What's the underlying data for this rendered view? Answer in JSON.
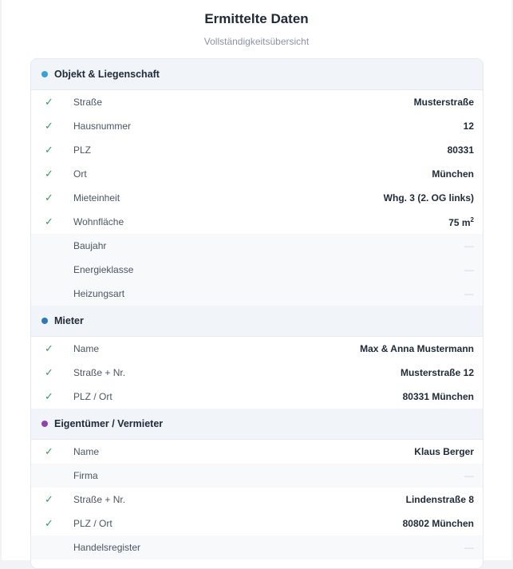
{
  "header": {
    "title": "Ermittelte Daten",
    "subtitle": "Vollständigkeitsübersicht"
  },
  "colors": {
    "check": "#2f9e63",
    "dot_objekt": "#3aa0d8",
    "dot_mieter": "#2f78b7",
    "dot_eigentuemer": "#8e44ad"
  },
  "icons": {
    "check": "✓",
    "empty": "—"
  },
  "sections": [
    {
      "title": "Objekt & Liegenschaft",
      "rows": [
        {
          "label": "Straße",
          "value": "Musterstraße",
          "filled": true
        },
        {
          "label": "Hausnummer",
          "value": "12",
          "filled": true
        },
        {
          "label": "PLZ",
          "value": "80331",
          "filled": true
        },
        {
          "label": "Ort",
          "value": "München",
          "filled": true
        },
        {
          "label": "Mieteinheit",
          "value": "Whg. 3 (2. OG links)",
          "filled": true
        },
        {
          "label": "Wohnfläche",
          "value": "75 m²",
          "filled": true
        },
        {
          "label": "Baujahr",
          "value": "—",
          "filled": false
        },
        {
          "label": "Energieklasse",
          "value": "—",
          "filled": false
        },
        {
          "label": "Heizungsart",
          "value": "—",
          "filled": false
        }
      ]
    },
    {
      "title": "Mieter",
      "rows": [
        {
          "label": "Name",
          "value": "Max & Anna Mustermann",
          "filled": true
        },
        {
          "label": "Straße + Nr.",
          "value": "Musterstraße 12",
          "filled": true
        },
        {
          "label": "PLZ / Ort",
          "value": "80331 München",
          "filled": true
        }
      ]
    },
    {
      "title": "Eigentümer / Vermieter",
      "rows": [
        {
          "label": "Name",
          "value": "Klaus Berger",
          "filled": true
        },
        {
          "label": "Firma",
          "value": "—",
          "filled": false
        },
        {
          "label": "Straße + Nr.",
          "value": "Lindenstraße 8",
          "filled": true
        },
        {
          "label": "PLZ / Ort",
          "value": "80802 München",
          "filled": true
        },
        {
          "label": "Handelsregister",
          "value": "—",
          "filled": false
        }
      ]
    }
  ]
}
